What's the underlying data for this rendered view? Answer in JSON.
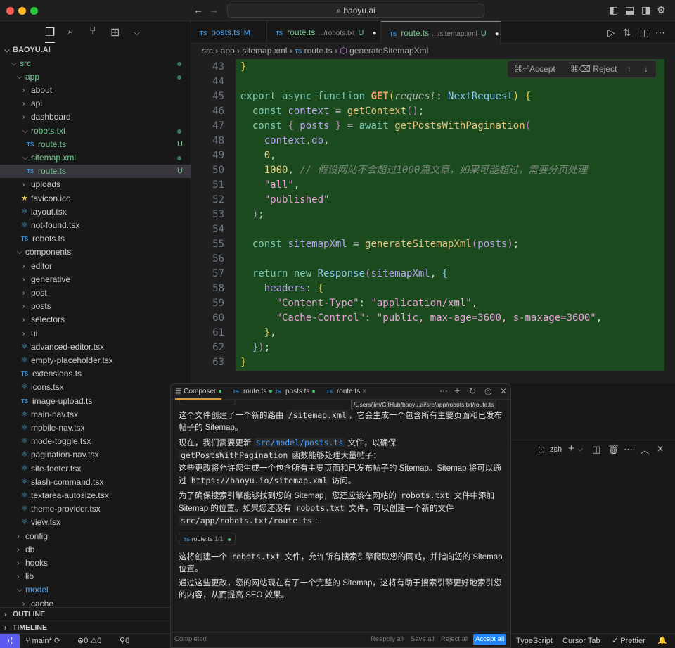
{
  "title": "baoyu.ai",
  "colors": {
    "accent": "#0078d4",
    "added": "#73c991",
    "diff_bg": "#1b4a1e",
    "remote": "#5a5af0"
  },
  "explorer": {
    "root": "BAOYU.AI",
    "items": [
      {
        "label": "src",
        "level": 1,
        "type": "folder",
        "open": true,
        "green": true,
        "dot": true
      },
      {
        "label": "app",
        "level": 2,
        "type": "folder",
        "open": true,
        "green": true,
        "dot": true
      },
      {
        "label": "about",
        "level": 3,
        "type": "folder"
      },
      {
        "label": "api",
        "level": 3,
        "type": "folder"
      },
      {
        "label": "dashboard",
        "level": 3,
        "type": "folder"
      },
      {
        "label": "robots.txt",
        "level": 3,
        "type": "folder",
        "open": true,
        "green": true,
        "dot": true
      },
      {
        "label": "route.ts",
        "level": 4,
        "type": "ts",
        "green": true,
        "badge": "U"
      },
      {
        "label": "sitemap.xml",
        "level": 3,
        "type": "folder",
        "open": true,
        "green": true,
        "dot": true
      },
      {
        "label": "route.ts",
        "level": 4,
        "type": "ts",
        "green": true,
        "badge": "U",
        "selected": true
      },
      {
        "label": "uploads",
        "level": 3,
        "type": "folder"
      },
      {
        "label": "favicon.ico",
        "level": 3,
        "type": "star"
      },
      {
        "label": "layout.tsx",
        "level": 3,
        "type": "react"
      },
      {
        "label": "not-found.tsx",
        "level": 3,
        "type": "react"
      },
      {
        "label": "robots.ts",
        "level": 3,
        "type": "ts"
      },
      {
        "label": "components",
        "level": 2,
        "type": "folder",
        "open": true
      },
      {
        "label": "editor",
        "level": 3,
        "type": "folder"
      },
      {
        "label": "generative",
        "level": 3,
        "type": "folder"
      },
      {
        "label": "post",
        "level": 3,
        "type": "folder"
      },
      {
        "label": "posts",
        "level": 3,
        "type": "folder"
      },
      {
        "label": "selectors",
        "level": 3,
        "type": "folder"
      },
      {
        "label": "ui",
        "level": 3,
        "type": "folder"
      },
      {
        "label": "advanced-editor.tsx",
        "level": 3,
        "type": "react"
      },
      {
        "label": "empty-placeholder.tsx",
        "level": 3,
        "type": "react"
      },
      {
        "label": "extensions.ts",
        "level": 3,
        "type": "ts"
      },
      {
        "label": "icons.tsx",
        "level": 3,
        "type": "react"
      },
      {
        "label": "image-upload.ts",
        "level": 3,
        "type": "ts"
      },
      {
        "label": "main-nav.tsx",
        "level": 3,
        "type": "react"
      },
      {
        "label": "mobile-nav.tsx",
        "level": 3,
        "type": "react"
      },
      {
        "label": "mode-toggle.tsx",
        "level": 3,
        "type": "react"
      },
      {
        "label": "pagination-nav.tsx",
        "level": 3,
        "type": "react"
      },
      {
        "label": "site-footer.tsx",
        "level": 3,
        "type": "react"
      },
      {
        "label": "slash-command.tsx",
        "level": 3,
        "type": "react"
      },
      {
        "label": "textarea-autosize.tsx",
        "level": 3,
        "type": "react"
      },
      {
        "label": "theme-provider.tsx",
        "level": 3,
        "type": "react"
      },
      {
        "label": "view.tsx",
        "level": 3,
        "type": "react"
      },
      {
        "label": "config",
        "level": 2,
        "type": "folder"
      },
      {
        "label": "db",
        "level": 2,
        "type": "folder"
      },
      {
        "label": "hooks",
        "level": 2,
        "type": "folder"
      },
      {
        "label": "lib",
        "level": 2,
        "type": "folder"
      },
      {
        "label": "model",
        "level": 2,
        "type": "folder",
        "open": true,
        "blue": true
      },
      {
        "label": "cache",
        "level": 3,
        "type": "folder"
      }
    ],
    "outline": "OUTLINE",
    "timeline": "TIMELINE"
  },
  "tabs": [
    {
      "name": "posts.ts",
      "path": "",
      "status": "M",
      "color": "#4aa0ef"
    },
    {
      "name": "route.ts",
      "path": ".../robots.txt",
      "status": "U",
      "color": "#73c991",
      "dirty": true
    },
    {
      "name": "route.ts",
      "path": ".../sitemap.xml",
      "status": "U",
      "color": "#73c991",
      "dirty": true,
      "active": true
    }
  ],
  "ts_label": "TS",
  "breadcrumb": [
    "src",
    "app",
    "sitemap.xml",
    "route.ts",
    "generateSitemapXml"
  ],
  "diff_widget": {
    "accept": "⌘⏎Accept",
    "reject": "⌘⌫ Reject"
  },
  "code": [
    {
      "n": 43,
      "t": [
        [
          "}",
          "br"
        ]
      ]
    },
    {
      "n": 44,
      "t": []
    },
    {
      "n": 45,
      "t": [
        [
          "export async function ",
          "kw"
        ],
        [
          "GET",
          "fb"
        ],
        [
          "(",
          "br"
        ],
        [
          "request",
          "cm2"
        ],
        [
          ": ",
          "pu"
        ],
        [
          "NextRequest",
          "ty"
        ],
        [
          ") ",
          "br"
        ],
        [
          "{",
          "br"
        ]
      ]
    },
    {
      "n": 46,
      "t": [
        [
          "  const ",
          "kw"
        ],
        [
          "context",
          "vr"
        ],
        [
          " = ",
          "pu"
        ],
        [
          "getContext",
          "fn"
        ],
        [
          "()",
          "bp"
        ],
        [
          ";",
          "pu"
        ]
      ]
    },
    {
      "n": 47,
      "t": [
        [
          "  const ",
          "kw"
        ],
        [
          "{ ",
          "bp"
        ],
        [
          "posts",
          "vr"
        ],
        [
          " }",
          "bp"
        ],
        [
          " = ",
          "pu"
        ],
        [
          "await ",
          "kw"
        ],
        [
          "getPostsWithPagination",
          "fn"
        ],
        [
          "(",
          "bp"
        ]
      ]
    },
    {
      "n": 48,
      "t": [
        [
          "    context",
          "vr"
        ],
        [
          ".",
          "pu"
        ],
        [
          "db",
          "vr"
        ],
        [
          ",",
          "pu"
        ]
      ]
    },
    {
      "n": 49,
      "t": [
        [
          "    0",
          "nu"
        ],
        [
          ",",
          "pu"
        ]
      ]
    },
    {
      "n": 50,
      "t": [
        [
          "    1000",
          "nu"
        ],
        [
          ", ",
          "pu"
        ],
        [
          "// 假设网站不会超过1000篇文章，如果可能超过，需要分页处理",
          "cm"
        ]
      ]
    },
    {
      "n": 51,
      "t": [
        [
          "    \"all\"",
          "st"
        ],
        [
          ",",
          "pu"
        ]
      ]
    },
    {
      "n": 52,
      "t": [
        [
          "    \"published\"",
          "st"
        ]
      ]
    },
    {
      "n": 53,
      "t": [
        [
          "  )",
          "bp"
        ],
        [
          ";",
          "pu"
        ]
      ]
    },
    {
      "n": 54,
      "t": []
    },
    {
      "n": 55,
      "t": [
        [
          "  const ",
          "kw"
        ],
        [
          "sitemapXml",
          "vr"
        ],
        [
          " = ",
          "pu"
        ],
        [
          "generateSitemapXml",
          "fn"
        ],
        [
          "(",
          "bp"
        ],
        [
          "posts",
          "vr"
        ],
        [
          ")",
          "bp"
        ],
        [
          ";",
          "pu"
        ]
      ]
    },
    {
      "n": 56,
      "t": []
    },
    {
      "n": 57,
      "t": [
        [
          "  return new ",
          "kw"
        ],
        [
          "Response",
          "ty"
        ],
        [
          "(",
          "bp"
        ],
        [
          "sitemapXml",
          "vr"
        ],
        [
          ", ",
          "pu"
        ],
        [
          "{",
          "ty"
        ]
      ]
    },
    {
      "n": 58,
      "t": [
        [
          "    headers",
          "vr"
        ],
        [
          ": ",
          "pu"
        ],
        [
          "{",
          "br"
        ]
      ]
    },
    {
      "n": 59,
      "t": [
        [
          "      \"Content-Type\"",
          "st"
        ],
        [
          ": ",
          "pu"
        ],
        [
          "\"application/xml\"",
          "st"
        ],
        [
          ",",
          "pu"
        ]
      ]
    },
    {
      "n": 60,
      "t": [
        [
          "      \"Cache-Control\"",
          "st"
        ],
        [
          ": ",
          "pu"
        ],
        [
          "\"public, max-age=3600, s-maxage=3600\"",
          "st"
        ],
        [
          ",",
          "pu"
        ]
      ]
    },
    {
      "n": 61,
      "t": [
        [
          "    }",
          "br"
        ],
        [
          ",",
          "pu"
        ]
      ]
    },
    {
      "n": 62,
      "t": [
        [
          "  }",
          "ty"
        ],
        [
          ")",
          "bp"
        ],
        [
          ";",
          "pu"
        ]
      ]
    },
    {
      "n": 63,
      "t": [
        [
          "}",
          "br"
        ]
      ]
    }
  ],
  "composer": {
    "tabs": [
      {
        "label": "Composer",
        "dot": true
      },
      {
        "label": "route.ts",
        "dot": true
      },
      {
        "label": "posts.ts",
        "dot": true
      },
      {
        "label": "route.ts",
        "close": true
      }
    ],
    "tooltip": "/Users/jim/GitHub/baoyu.ai/src/app/robots.txt/route.ts",
    "paragraphs": [
      [
        [
          "这个文件创建了一个新的路由 "
        ],
        [
          "/sitemap.xml",
          "code"
        ],
        [
          "，它会生成一个包含所有主要页面和已发布帖子的 Sitemap。"
        ]
      ],
      [
        [
          "现在，我们需要更新 "
        ],
        [
          "src/model/posts.ts",
          "link"
        ],
        [
          " 文件，以确保 "
        ],
        [
          "getPostsWithPagination",
          "code"
        ],
        [
          " 函数能够处理大量帖子："
        ]
      ],
      [
        [
          "这些更改将允许您生成一个包含所有主要页面和已发布帖子的 Sitemap。Sitemap 将可以通过 "
        ],
        [
          "https://baoyu.io/sitemap.xml",
          "code"
        ],
        [
          " 访问。"
        ]
      ],
      [
        [
          "为了确保搜索引擎能够找到您的 Sitemap，您还应该在网站的 "
        ],
        [
          "robots.txt",
          "code"
        ],
        [
          " 文件中添加 Sitemap 的位置。如果您还没有 "
        ],
        [
          "robots.txt",
          "code"
        ],
        [
          " 文件，可以创建一个新的文件 "
        ],
        [
          "src/app/robots.txt/route.ts",
          "code"
        ],
        [
          "："
        ]
      ],
      [
        [
          "这将创建一个 "
        ],
        [
          "robots.txt",
          "code"
        ],
        [
          " 文件，允许所有搜索引擎爬取您的网站，并指向您的 Sitemap 位置。"
        ]
      ],
      [
        [
          "通过这些更改，您的网站现在有了一个完整的 Sitemap，这将有助于搜索引擎更好地索引您的内容，从而提高 SEO 效果。"
        ]
      ]
    ],
    "chip": {
      "file": "route.ts",
      "count": "1/1"
    },
    "footer": {
      "status": "Completed",
      "reapply": "Reapply all",
      "save": "Save all",
      "reject": "Reject all",
      "accept": "Accept all"
    }
  },
  "terminal": {
    "shell": "zsh"
  },
  "status": {
    "branch": "main*",
    "errors": "0",
    "warnings": "0",
    "ports": "0",
    "language": "TypeScript",
    "cursor_tab": "Cursor Tab",
    "prettier": "Prettier"
  }
}
